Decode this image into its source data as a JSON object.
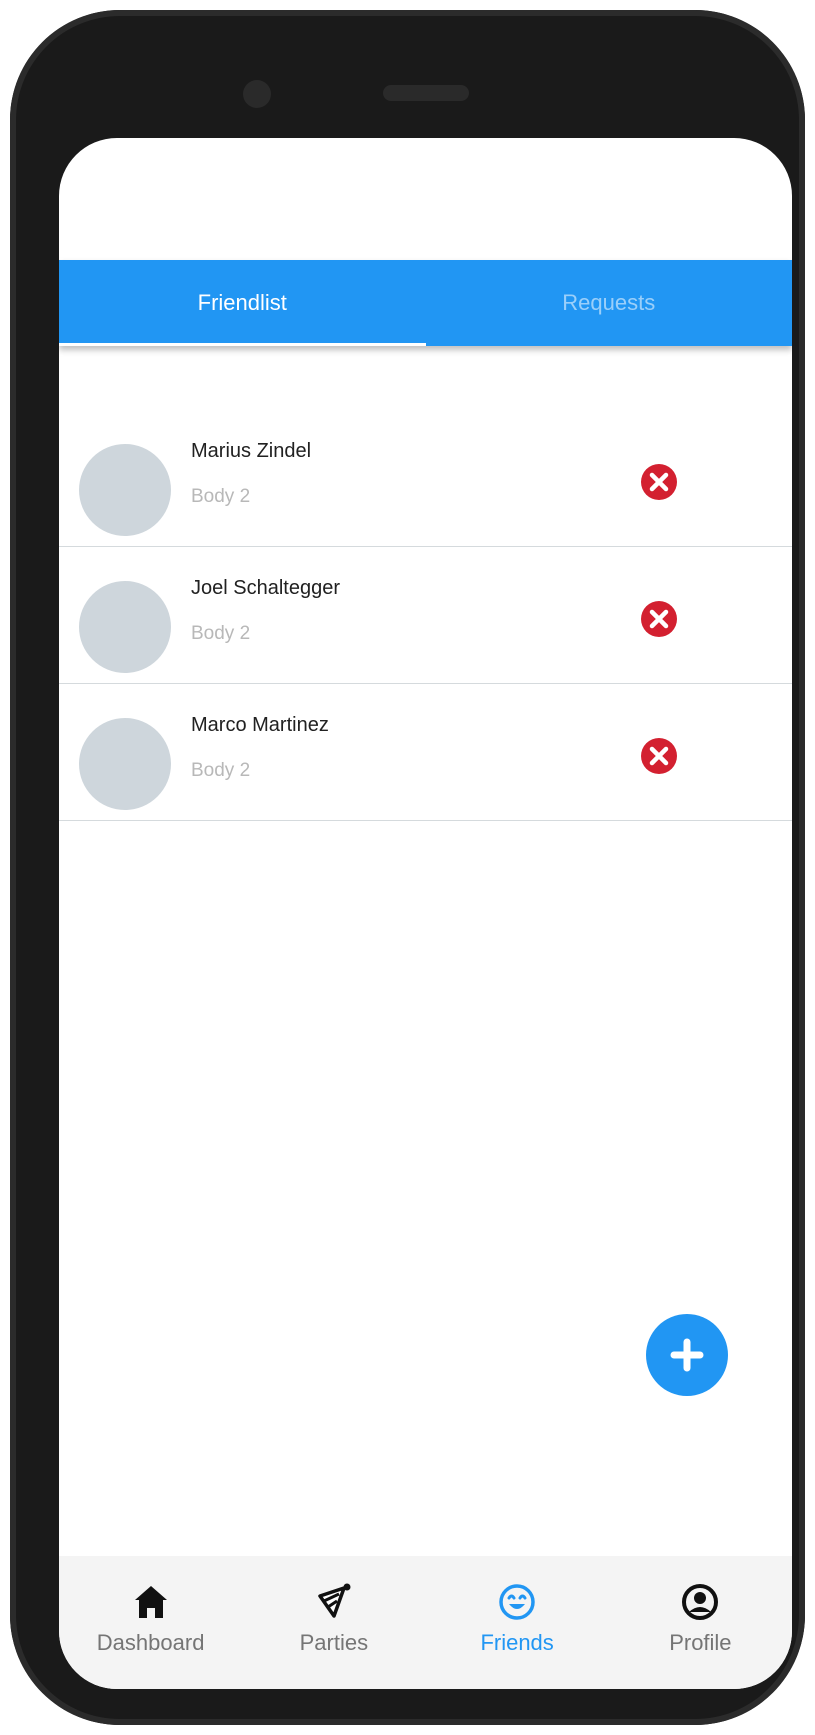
{
  "tabs": [
    {
      "label": "Friendlist",
      "active": true
    },
    {
      "label": "Requests",
      "active": false
    }
  ],
  "friends": [
    {
      "name": "Marius Zindel",
      "subtitle": "Body 2"
    },
    {
      "name": "Joel Schaltegger",
      "subtitle": "Body 2"
    },
    {
      "name": "Marco Martinez",
      "subtitle": "Body 2"
    }
  ],
  "fab": {
    "icon": "plus-icon"
  },
  "bottom_nav": [
    {
      "label": "Dashboard",
      "icon": "home-icon",
      "active": false
    },
    {
      "label": "Parties",
      "icon": "party-hat-icon",
      "active": false
    },
    {
      "label": "Friends",
      "icon": "smiley-icon",
      "active": true
    },
    {
      "label": "Profile",
      "icon": "account-circle-icon",
      "active": false
    }
  ],
  "colors": {
    "primary": "#2196f3",
    "remove": "#d32030",
    "avatar": "#ced6dc"
  }
}
